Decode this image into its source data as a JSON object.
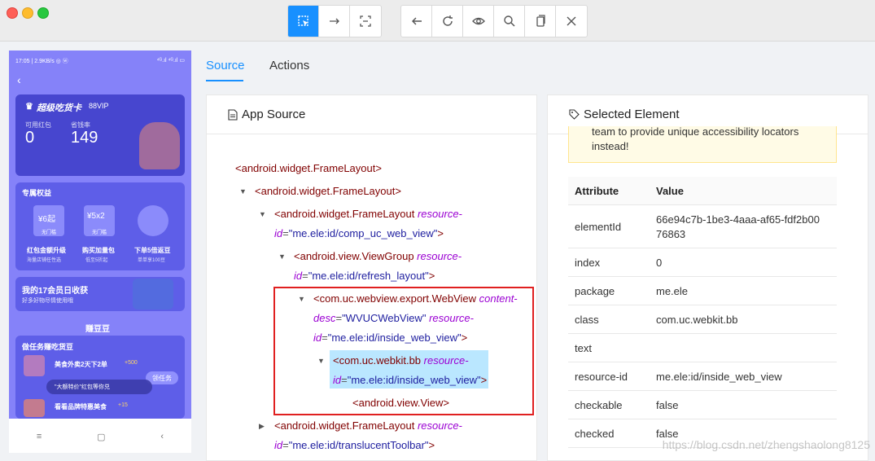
{
  "toolbar": {
    "buttons": [
      {
        "name": "select-element-icon",
        "glyph": "⬚",
        "active": true
      },
      {
        "name": "swipe-icon",
        "glyph": "→"
      },
      {
        "name": "tap-by-coordinates-icon",
        "glyph": "⛶"
      },
      {
        "name": "back-arrow-icon",
        "glyph": "←"
      },
      {
        "name": "refresh-icon",
        "glyph": "↻"
      },
      {
        "name": "eye-icon",
        "glyph": "◉"
      },
      {
        "name": "search-icon",
        "glyph": "⚲"
      },
      {
        "name": "copy-xml-icon",
        "glyph": "▯"
      },
      {
        "name": "close-icon",
        "glyph": "✕"
      }
    ]
  },
  "phone": {
    "status": "17:05 | 2.9KB/s  ◎ ⓦ",
    "status_right": "⁴ᴳ.ıl ⁴ᴳ.ıl ▭",
    "vip_title": "超级吃货卡",
    "vip_badge": "88VIP",
    "stat1_label": "可用红包",
    "stat1_value": "0",
    "stat2_label": "省钱率",
    "stat2_value": "149",
    "section1": "专属权益",
    "benefit1_value": "¥6起",
    "benefit1_tag": "无门槛",
    "benefit1_name": "红包金额升级",
    "benefit1_sub": "海量店铺任性选",
    "benefit2_value": "¥5x2",
    "benefit2_tag": "无门槛",
    "benefit2_name": "购买加量包",
    "benefit2_sub": "低至5折起",
    "benefit3_name": "下单5倍返豆",
    "benefit3_sub": "单单享100豆",
    "members_title": "我的17会员日收获",
    "members_sub": "好多好物尽情使用哦",
    "beans": "赚豆豆",
    "tasks": "做任务赚吃货豆",
    "task1": "美食外卖2天下2单",
    "task1_points": "+500",
    "toast": "\"大额特价\"红包等你兑",
    "task2": "看看品牌特惠美食",
    "task2_points": "+15",
    "task_btn": "领任务",
    "nav": [
      "≡",
      "▢",
      "‹"
    ]
  },
  "tabs": {
    "source": "Source",
    "actions": "Actions"
  },
  "source_panel": {
    "title": "App Source",
    "icon": "file-icon"
  },
  "tree": [
    {
      "tag": "<android.widget.FrameLayout>"
    },
    {
      "tag": "<android.widget.FrameLayout>"
    },
    {
      "tag": "<android.widget.FrameLayout ",
      "attr": "resource-",
      "line2_attr": "id",
      "line2_val": "\"me.ele:id/comp_uc_web_view\""
    },
    {
      "tag": "<android.view.ViewGroup ",
      "attr": "resource-",
      "line2_attr": "id",
      "line2_val": "\"me.ele:id/refresh_layout\""
    },
    {
      "tag": "<com.uc.webview.export.WebView ",
      "attr": "content-",
      "line2_attr": "desc",
      "line2_val": "\"WVUCWebView\"",
      "line2_attr2": "resource-",
      "line3_attr": "id",
      "line3_val": "\"me.ele:id/inside_web_view\""
    },
    {
      "tag": "<com.uc.webkit.bb ",
      "attr": "resource-",
      "line2_attr": "id",
      "line2_val": "\"me.ele:id/inside_web_view\""
    },
    {
      "tag": "<android.view.View>"
    },
    {
      "tag": "<android.widget.FrameLayout ",
      "attr": "resource-",
      "line2_attr": "id",
      "line2_val": "\"me.ele:id/translucentToolbar\""
    }
  ],
  "selected_panel": {
    "title": "Selected Element",
    "warning_line1": "team to provide unique accessibility locators",
    "warning_line2": "instead!",
    "col_attr": "Attribute",
    "col_value": "Value",
    "rows": [
      {
        "k": "elementId",
        "v": "66e94c7b-1be3-4aaa-af65-fdf2b00 76863"
      },
      {
        "k": "index",
        "v": "0"
      },
      {
        "k": "package",
        "v": "me.ele"
      },
      {
        "k": "class",
        "v": "com.uc.webkit.bb"
      },
      {
        "k": "text",
        "v": ""
      },
      {
        "k": "resource-id",
        "v": "me.ele:id/inside_web_view"
      },
      {
        "k": "checkable",
        "v": "false"
      },
      {
        "k": "checked",
        "v": "false"
      }
    ]
  },
  "watermark": "https://blog.csdn.net/zhengshaolong8125"
}
